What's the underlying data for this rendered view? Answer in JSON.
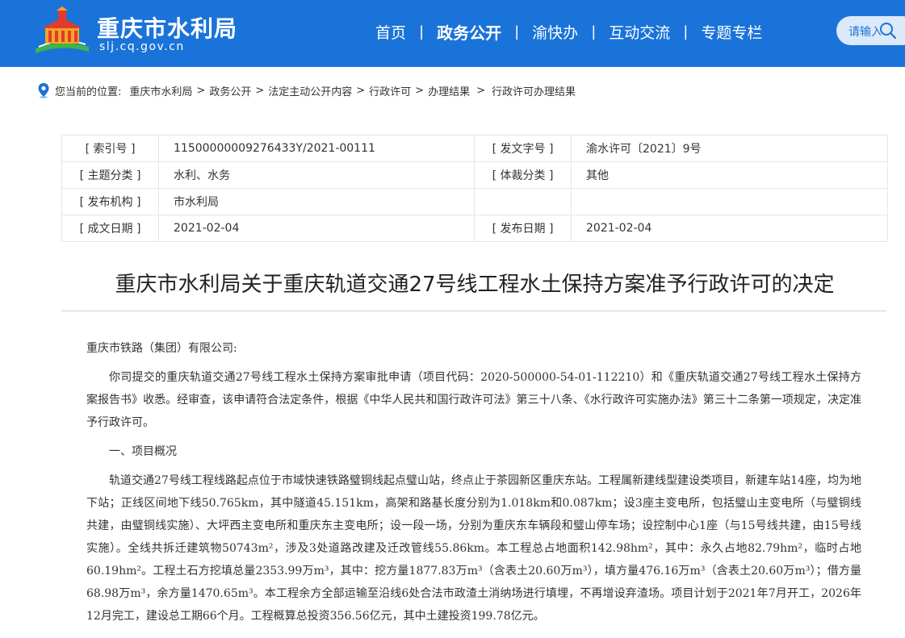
{
  "header": {
    "site_name": "重庆市水利局",
    "site_domain": "slj.cq.gov.cn",
    "nav": [
      "首页",
      "政务公开",
      "渝快办",
      "互动交流",
      "专题专栏"
    ],
    "nav_active_index": 1,
    "search_placeholder": "请输入",
    "brand_color": "#1a73d9"
  },
  "breadcrumb": {
    "prefix": "您当前的位置:",
    "items": [
      "重庆市水利局",
      "政务公开",
      "法定主动公开内容",
      "行政许可",
      "办理结果",
      "行政许可办理结果"
    ],
    "sep": ">"
  },
  "meta": {
    "index_label": "[ 索引号 ]",
    "index_value": "11500000009276433Y/2021-00111",
    "doc_no_label": "[ 发文字号 ]",
    "doc_no_value": "渝水许可〔2021〕9号",
    "topic_label": "[ 主题分类 ]",
    "topic_value": "水利、水务",
    "genre_label": "[ 体裁分类 ]",
    "genre_value": "其他",
    "issuer_label": "[ 发布机构 ]",
    "issuer_value": "市水利局",
    "created_label": "[ 成文日期 ]",
    "created_value": "2021-02-04",
    "published_label": "[ 发布日期 ]",
    "published_value": "2021-02-04"
  },
  "document": {
    "title": "重庆市水利局关于重庆轨道交通27号线工程水土保持方案准予行政许可的决定",
    "salutation": "重庆市铁路（集团）有限公司:",
    "para1": "你司提交的重庆轨道交通27号线工程水土保持方案审批申请（项目代码：2020-500000-54-01-112210）和《重庆轨道交通27号线工程水土保持方案报告书》收悉。经审查，该申请符合法定条件，根据《中华人民共和国行政许可法》第三十八条、《水行政许可实施办法》第三十二条第一项规定，决定准予行政许可。",
    "section1": "一、项目概况",
    "para2": "轨道交通27号线工程线路起点位于市域快速铁路璧铜线起点璧山站，终点止于茶园新区重庆东站。工程属新建线型建设类项目，新建车站14座，均为地下站；正线区间地下线50.765km，其中隧道45.151km，高架和路基长度分别为1.018km和0.087km；设3座主变电所，包括璧山主变电所（与璧铜线共建，由璧铜线实施）、大坪西主变电所和重庆东主变电所；设一段一场，分别为重庆东车辆段和璧山停车场；设控制中心1座（与15号线共建，由15号线实施）。全线共拆迁建筑物50743m²，涉及3处道路改建及迁改管线55.86km。本工程总占地面积142.98hm²，其中：永久占地82.79hm²，临时占地60.19hm²。工程土石方挖填总量2353.99万m³，其中：挖方量1877.83万m³（含表土20.60万m³），填方量476.16万m³（含表土20.60万m³）；借方量68.98万m³，余方量1470.65m³。本工程余方全部运输至沿线6处合法市政渣土消纳场进行填埋，不再增设弃渣场。项目计划于2021年7月开工，2026年12月完工，建设总工期66个月。工程概算总投资356.56亿元，其中土建投资199.78亿元。"
  }
}
